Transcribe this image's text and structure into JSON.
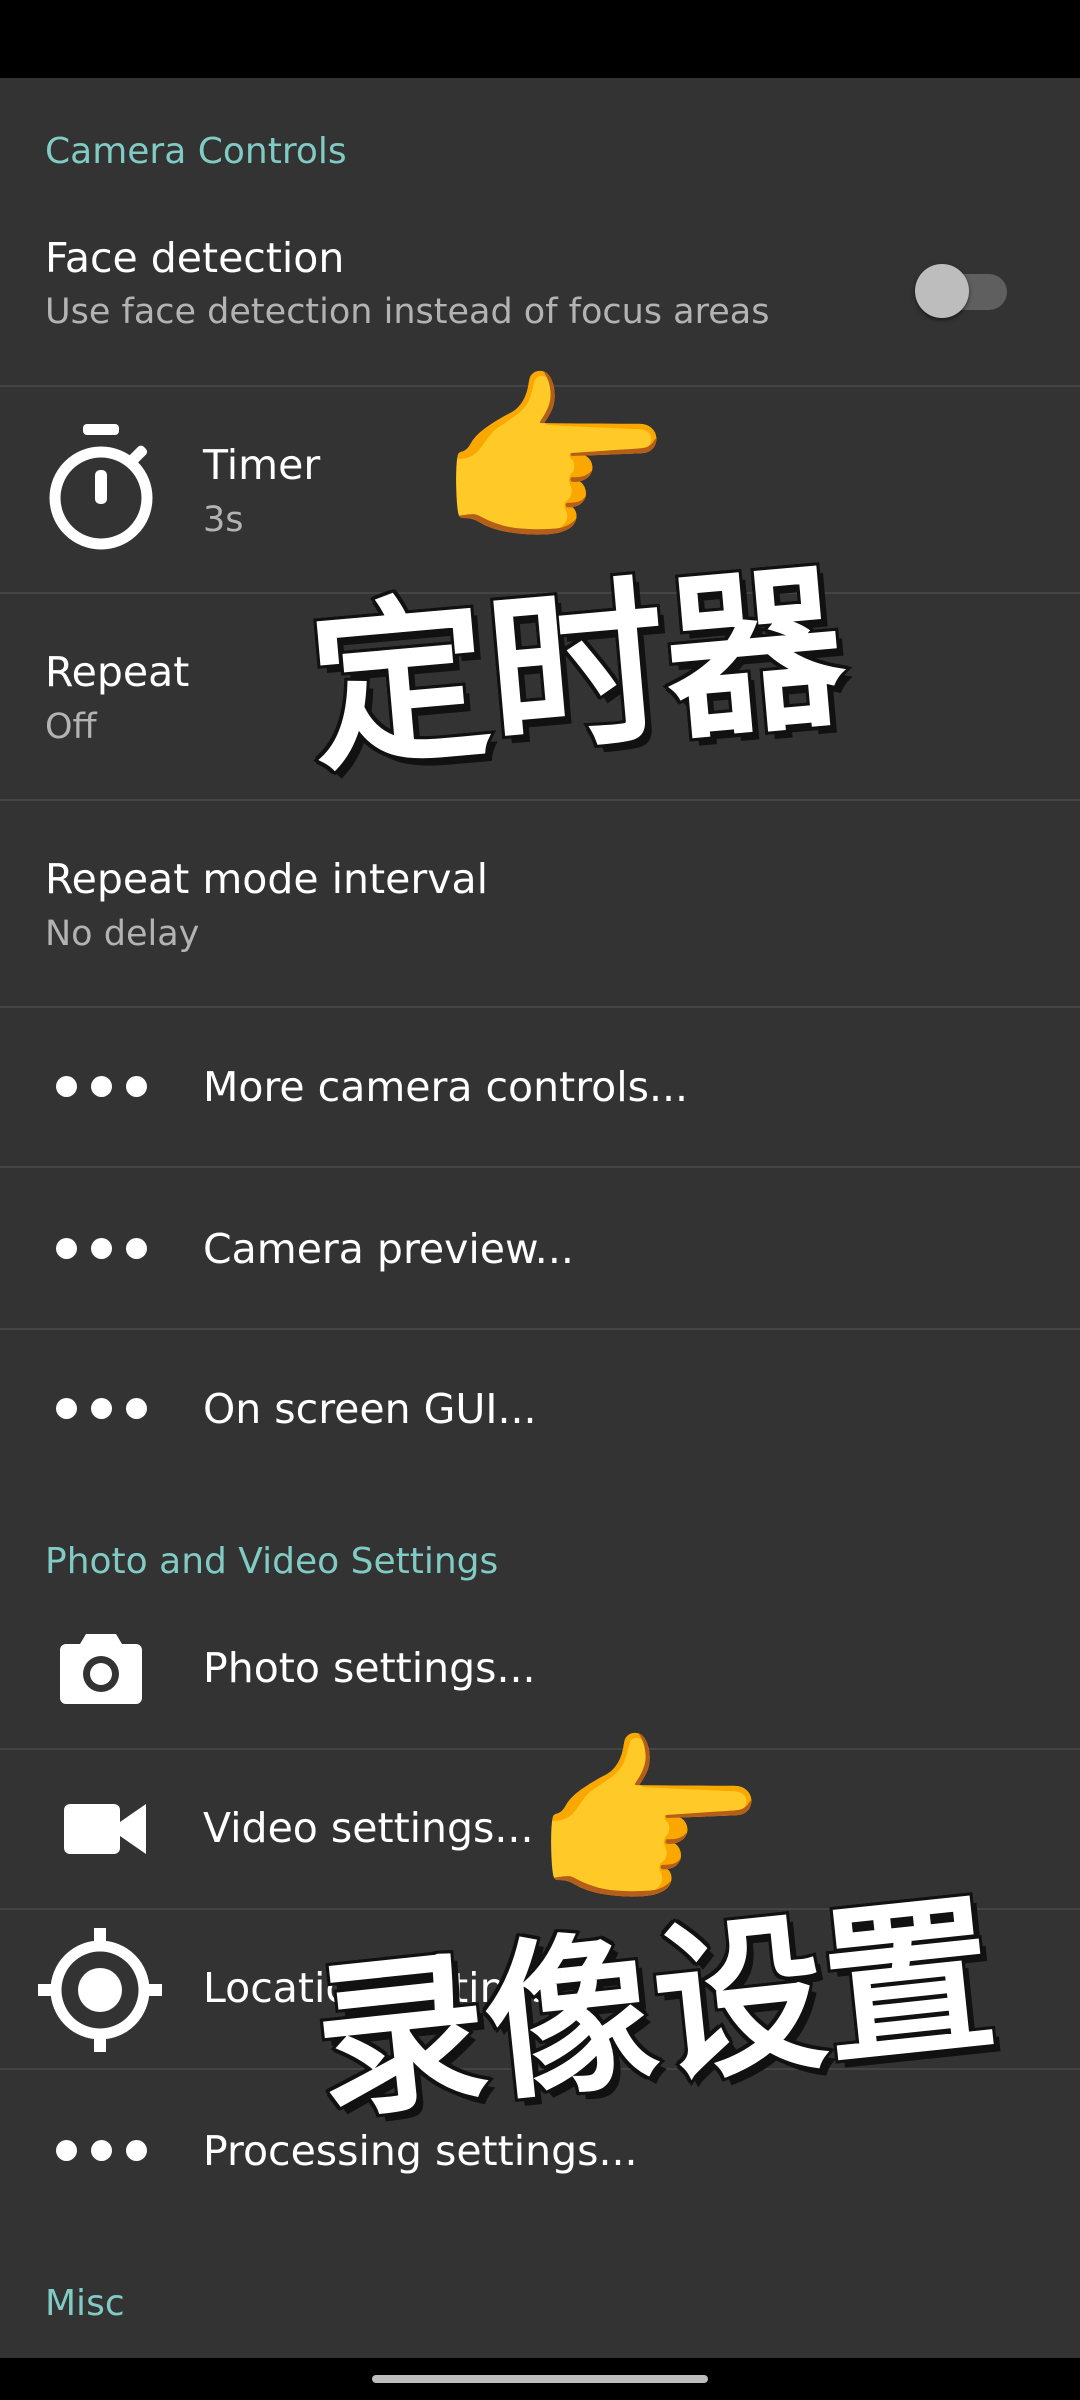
{
  "sections": {
    "camera_controls": "Camera Controls",
    "photo_video": "Photo and Video Settings",
    "misc": "Misc"
  },
  "face_detection": {
    "title": "Face detection",
    "summary": "Use face detection instead of focus areas",
    "enabled": false
  },
  "timer": {
    "title": "Timer",
    "summary": "3s",
    "icon": "timer-icon"
  },
  "repeat": {
    "title": "Repeat",
    "summary": "Off"
  },
  "repeat_interval": {
    "title": "Repeat mode interval",
    "summary": "No delay"
  },
  "menu": {
    "more_camera_controls": "More camera controls...",
    "camera_preview": "Camera preview...",
    "on_screen_gui": "On screen GUI...",
    "photo_settings": "Photo settings...",
    "video_settings": "Video settings...",
    "location_settings": "Location settings...",
    "processing_settings": "Processing settings..."
  },
  "overlay": {
    "timer_caption": "定时器",
    "video_caption": "录像设置",
    "pointer_emoji": "👉"
  },
  "colors": {
    "background": "#333333",
    "section_header": "#80cbc4",
    "divider": "#444444",
    "summary_text": "#b3b3b3"
  }
}
